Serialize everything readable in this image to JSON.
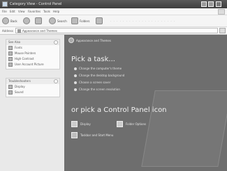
{
  "window": {
    "title": "Category View - Control Panel"
  },
  "menu": [
    "File",
    "Edit",
    "View",
    "Favorites",
    "Tools",
    "Help"
  ],
  "toolbar": {
    "back_label": "Back",
    "search_label": "Search",
    "folders_label": "Folders"
  },
  "address": {
    "label": "Address",
    "value": "Appearance and Themes"
  },
  "taskpane": {
    "see_also": {
      "header": "See Also",
      "items": [
        "Fonts",
        "Mouse Pointers",
        "High Contrast",
        "User Account Picture"
      ]
    },
    "troubleshooters": {
      "header": "Troubleshooters",
      "items": [
        "Display",
        "Sound"
      ]
    }
  },
  "main": {
    "breadcrumb": "Appearance and Themes",
    "pick_task": "Pick a task...",
    "tasks": [
      "Change the computer's theme",
      "Change the desktop background",
      "Choose a screen saver",
      "Change the screen resolution"
    ],
    "pick_icon": "or pick a Control Panel icon",
    "icons": [
      "Display",
      "Folder Options",
      "Taskbar and Start Menu"
    ]
  }
}
